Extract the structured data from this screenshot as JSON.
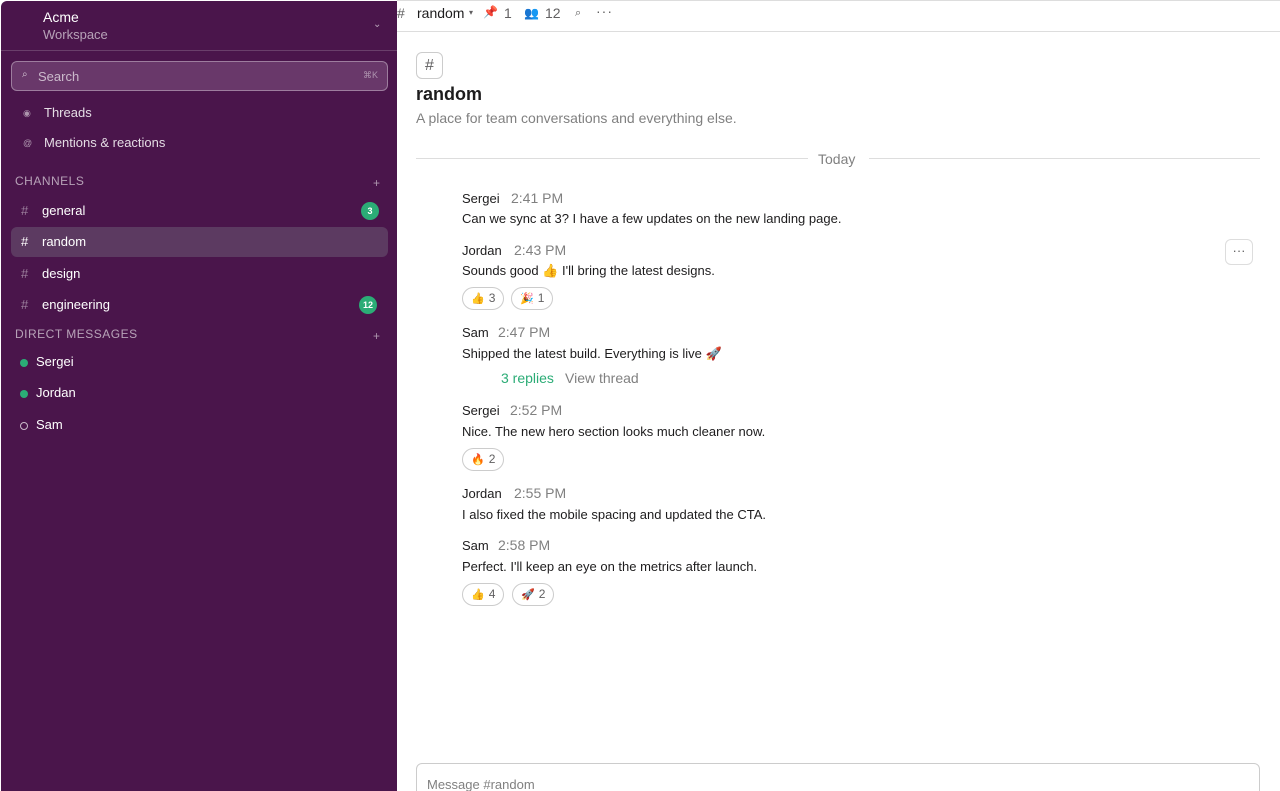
{
  "workspace": {
    "name": "Acme",
    "subtitle": "Workspace"
  },
  "search": {
    "label": "Search",
    "shortcut": "⌘K"
  },
  "nav": [
    {
      "label": "Threads",
      "icon": "threads-icon"
    },
    {
      "label": "Mentions & reactions",
      "icon": "mentions-icon"
    }
  ],
  "channels": {
    "title": "CHANNELS",
    "items": [
      {
        "label": "general",
        "badge": "3"
      },
      {
        "label": "random",
        "badge": ""
      },
      {
        "label": "design",
        "badge": ""
      },
      {
        "label": "engineering",
        "badge": "12"
      }
    ]
  },
  "direct_messages": {
    "title": "DIRECT MESSAGES",
    "items": [
      {
        "label": "Sergei",
        "status": "online"
      },
      {
        "label": "Jordan",
        "status": "online"
      },
      {
        "label": "Sam",
        "status": "away"
      }
    ]
  },
  "header": {
    "hash": "#",
    "channel": "random",
    "pins": "1",
    "members": "12"
  },
  "intro": {
    "icon": "#",
    "title": "random",
    "description": "A place for team conversations and everything else."
  },
  "divider": "Today",
  "messages": [
    {
      "author": "Sergei",
      "time": "2:41 PM",
      "text": "Can we sync at 3? I have a few updates on the new landing page."
    },
    {
      "author": "Jordan",
      "time": "2:43 PM",
      "text": "Sounds good 👍  I'll bring the latest designs.",
      "reactions": [
        {
          "emoji": "👍",
          "count": "3"
        },
        {
          "emoji": "🎉",
          "count": "1"
        }
      ]
    },
    {
      "author": "Sam",
      "time": "2:47 PM",
      "text": "Shipped the latest build. Everything is live 🚀",
      "thread": {
        "replies": "3 replies",
        "view": "View thread"
      }
    },
    {
      "author": "Sergei",
      "time": "2:52 PM",
      "text": "Nice. The new hero section looks much cleaner now.",
      "reactions": [
        {
          "emoji": "🔥",
          "count": "2"
        }
      ]
    },
    {
      "author": "Jordan",
      "time": "2:55 PM",
      "text": "I also fixed the mobile spacing and updated the CTA."
    },
    {
      "author": "Sam",
      "time": "2:58 PM",
      "text": "Perfect. I'll keep an eye on the metrics after launch.",
      "reactions": [
        {
          "emoji": "👍",
          "count": "4"
        },
        {
          "emoji": "🚀",
          "count": "2"
        }
      ]
    }
  ],
  "composer": {
    "placeholder": "Message #random"
  },
  "colors": {
    "sidebar": "#4a154b",
    "active_item": "#5c3a61",
    "badge": "#2bac76",
    "link": "#2bac76"
  }
}
